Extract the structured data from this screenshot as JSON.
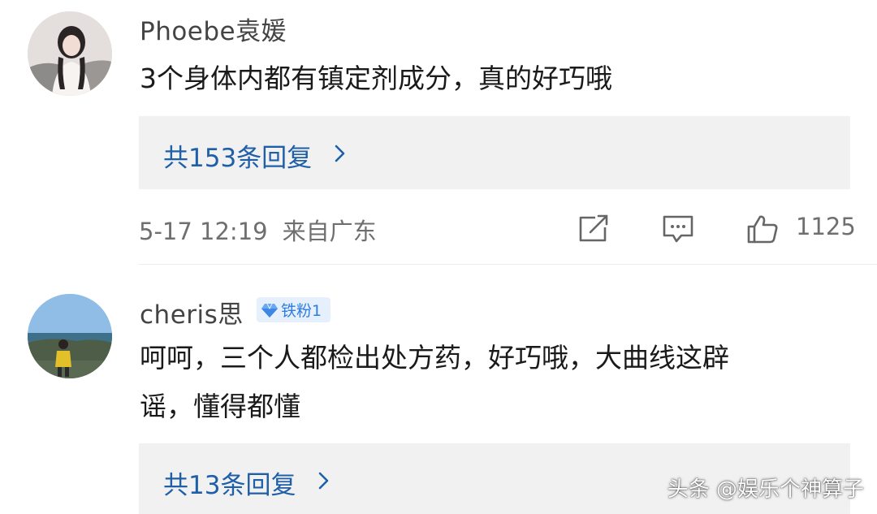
{
  "comments": [
    {
      "username": "Phoebe袁媛",
      "text_lines": [
        "3个身体内都有镇定剂成分，真的好巧哦"
      ],
      "replies_label": "共153条回复",
      "time": "5-17 12:19",
      "location": "来自广东",
      "like_count": "1125"
    },
    {
      "username": "cheris思",
      "badge": "铁粉1",
      "text_lines": [
        "呵呵，三个人都检出处方药，好巧哦，大曲线这辟",
        "谣，懂得都懂"
      ],
      "replies_label": "共13条回复"
    }
  ],
  "watermark": "头条 @娱乐个神算子",
  "colors": {
    "link": "#1e5fa8",
    "badge_bg": "#e6f0fd",
    "badge_text": "#2f7de1",
    "reply_box_bg": "#f1f1f1"
  },
  "icons": [
    "repost-icon",
    "comment-icon",
    "like-icon",
    "chevron-right-icon",
    "diamond-badge-icon"
  ]
}
